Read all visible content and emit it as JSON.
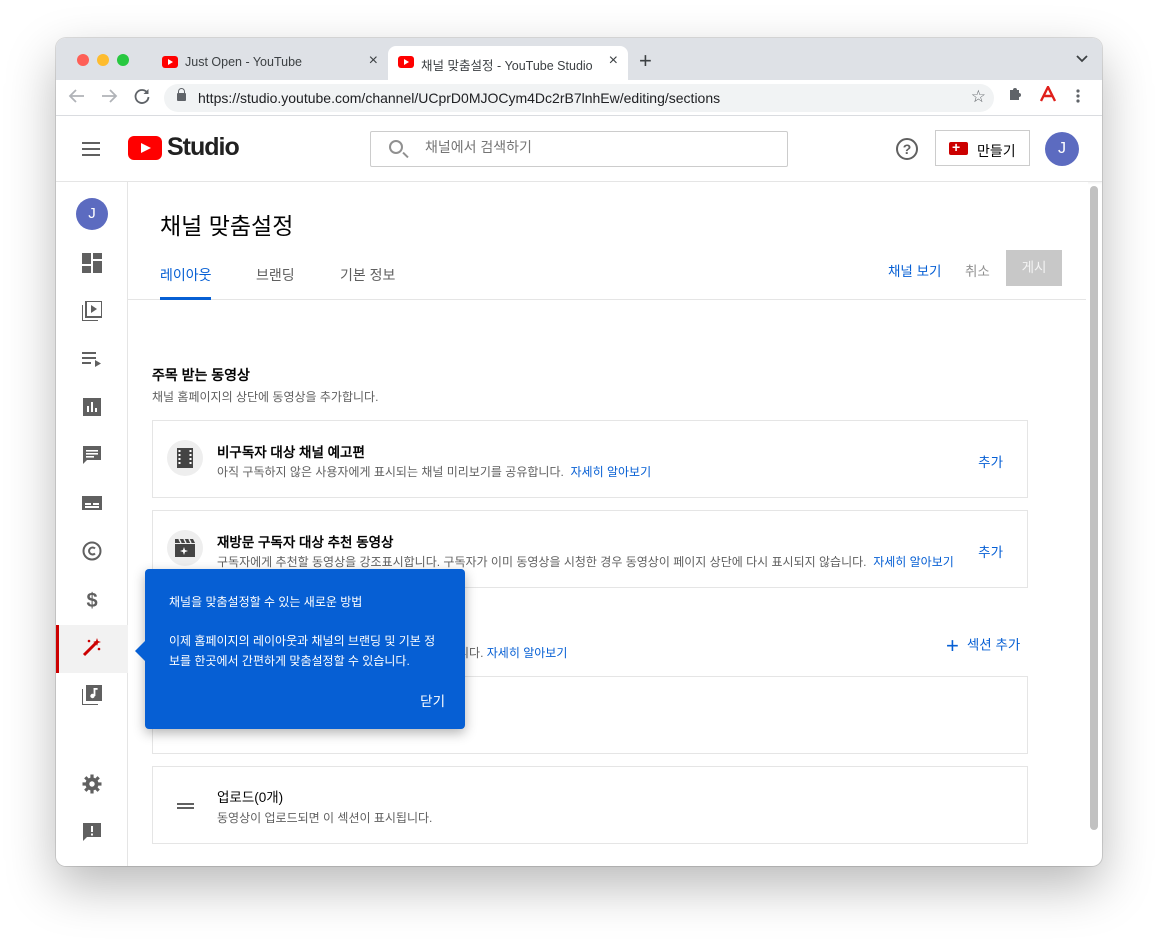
{
  "browser": {
    "tabs": [
      {
        "title": "Just Open - YouTube",
        "close": "×"
      },
      {
        "title": "채널 맞춤설정 - YouTube Studio",
        "close": "×"
      }
    ],
    "new_tab": "+",
    "tab_menu": "⌄",
    "url": "https://studio.youtube.com/channel/UCprD0MJOCym4Dc2rB7lnhEw/editing/sections"
  },
  "header": {
    "logo_text": "Studio",
    "search_placeholder": "채널에서 검색하기",
    "help": "?",
    "create_label": "만들기",
    "avatar_initial": "J"
  },
  "sidebar": {
    "avatar_initial": "J",
    "items": [
      {
        "name": "dashboard-icon",
        "glyph": "▦"
      },
      {
        "name": "content-icon",
        "glyph": "▶"
      },
      {
        "name": "playlists-icon",
        "glyph": "≡"
      },
      {
        "name": "analytics-icon",
        "glyph": "▮"
      },
      {
        "name": "comments-icon",
        "glyph": "▤"
      },
      {
        "name": "subtitles-icon",
        "glyph": "▭"
      },
      {
        "name": "copyright-icon",
        "glyph": "©"
      },
      {
        "name": "monetization-icon",
        "glyph": "$"
      },
      {
        "name": "customization-icon",
        "glyph": "✨"
      },
      {
        "name": "audio-library-icon",
        "glyph": "♪"
      },
      {
        "name": "settings-icon",
        "glyph": "⚙"
      },
      {
        "name": "feedback-icon",
        "glyph": "!"
      }
    ]
  },
  "page": {
    "title": "채널 맞춤설정",
    "tabs": [
      "레이아웃",
      "브랜딩",
      "기본 정보"
    ],
    "view_channel": "채널 보기",
    "cancel": "취소",
    "publish": "게시"
  },
  "featured": {
    "title": "주목 받는 동영상",
    "desc": "채널 홈페이지의 상단에 동영상을 추가합니다.",
    "cards": [
      {
        "title": "비구독자 대상 채널 예고편",
        "desc": "아직 구독하지 않은 사용자에게 표시되는 채널 미리보기를 공유합니다.",
        "link": "자세히 알아보기",
        "add": "추가"
      },
      {
        "title": "재방문 구독자 대상 추천 동영상",
        "desc": "구독자에게 추천할 동영상을 강조표시합니다. 구독자가 이미 동영상을 시청한 경우 동영상이 페이지 상단에 다시 표시되지 않습니다.",
        "link": "자세히 알아보기",
        "add": "추가"
      }
    ]
  },
  "sections": {
    "desc_tail": "니다.",
    "link": "자세히 알아보기",
    "add_section": "섹션 추가",
    "uploads_title": "업로드(0개)",
    "uploads_desc": "동영상이 업로드되면 이 섹션이 표시됩니다."
  },
  "popup": {
    "title": "채널을 맞춤설정할 수 있는 새로운 방법",
    "body": "이제 홈페이지의 레이아웃과 채널의 브랜딩 및 기본 정보를 한곳에서 간편하게 맞춤설정할 수 있습니다.",
    "close": "닫기"
  }
}
